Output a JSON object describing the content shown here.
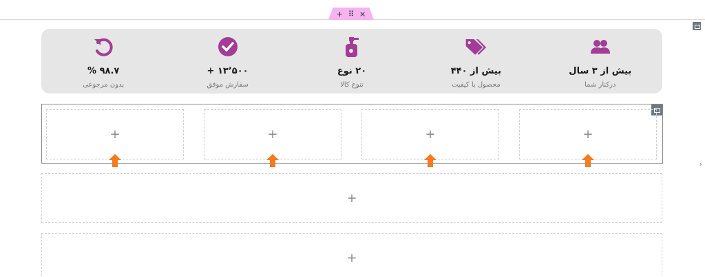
{
  "editor": {
    "handle": {
      "add_symbol": "+",
      "drag_symbol": "⠿",
      "close_symbol": "×"
    },
    "side_arrow": "›"
  },
  "stats": [
    {
      "icon": "users-icon",
      "title": "بیش از ۳ سال",
      "subtitle": "درکنار شما"
    },
    {
      "icon": "tags-icon",
      "title": "بیش از ۴۴۰",
      "subtitle": "محصول با کیفیت"
    },
    {
      "icon": "spray-bottle-icon",
      "title": "۲۰ نوع",
      "subtitle": "تنوع کالا"
    },
    {
      "icon": "check-circle-icon",
      "title": "۱۳٬۵۰۰ +",
      "subtitle": "سفارش موفق"
    },
    {
      "icon": "undo-icon",
      "title": "۹۸.۷ %",
      "subtitle": "بدون مرجوعی"
    }
  ],
  "columns": [
    {
      "placeholder": "+"
    },
    {
      "placeholder": "+"
    },
    {
      "placeholder": "+"
    },
    {
      "placeholder": "+"
    }
  ],
  "empty_sections": [
    {
      "placeholder": "+"
    },
    {
      "placeholder": "+"
    }
  ],
  "colors": {
    "accent": "#a23c96",
    "arrow": "#f47b20",
    "handle": "#f5b3ef"
  }
}
